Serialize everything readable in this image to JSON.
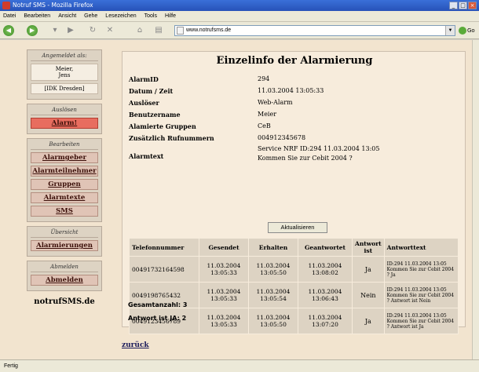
{
  "window": {
    "title": "Notruf SMS - Mozilla Firefox"
  },
  "menu": [
    "Datei",
    "Bearbeiten",
    "Ansicht",
    "Gehe",
    "Lesezeichen",
    "Tools",
    "Hilfe"
  ],
  "navbar": {
    "url": "www.notrufsms.de",
    "go_label": "Go"
  },
  "sidebar": {
    "logged_in_head": "Angemeldet als:",
    "user_line1": "Meier,",
    "user_line2": "Jens",
    "org": "[IDK Dresden]",
    "trigger_head": "Auslösen",
    "alarm_link": "Alarm!",
    "edit_head": "Bearbeiten",
    "edit_links": [
      "Alarmgeber",
      "Alarmteilnehmer",
      "Gruppen",
      "Alarmtexte",
      "SMS"
    ],
    "overview_head": "Übersicht",
    "overview_link": "Alarmierungen",
    "logout_head": "Abmelden",
    "logout_link": "Abmelden",
    "brand": "notrufSMS.de"
  },
  "main": {
    "title": "Einzelinfo der Alarmierung",
    "fields": [
      {
        "label": "AlarmID",
        "value": "294"
      },
      {
        "label": "Datum / Zeit",
        "value": "11.03.2004 13:05:33"
      },
      {
        "label": "Auslöser",
        "value": "Web-Alarm"
      },
      {
        "label": "Benutzername",
        "value": "Meier"
      },
      {
        "label": "Alamierte Gruppen",
        "value": "CeB"
      },
      {
        "label": "Zusätzlich Rufnummern",
        "value": "004912345678"
      }
    ],
    "alarm_text_label": "Alarmtext",
    "alarm_text_line1": "Service NRF ID:294 11.03.2004 13:05",
    "alarm_text_line2": "Kommen Sie zur Cebit 2004 ?",
    "refresh_label": "Aktualisieren",
    "table": {
      "headers": [
        "Telefonnummer",
        "Gesendet",
        "Erhalten",
        "Geantwortet",
        "Antwort ist",
        "Antworttext"
      ],
      "rows": [
        {
          "phone": "00491732164598",
          "sent": "11.03.2004 13:05:33",
          "received": "11.03.2004 13:05:50",
          "answered": "11.03.2004 13:08:02",
          "answer": "Ja",
          "reply": "ID:294 11.03.2004 13:05 Kommen Sie zur Cebit 2004 ? Ja"
        },
        {
          "phone": "0049198765432",
          "sent": "11.03.2004 13:05:33",
          "received": "11.03.2004 13:05:54",
          "answered": "11.03.2004 13:06:43",
          "answer": "Nein",
          "reply": "ID:294 11.03.2004 13:05 Kommen Sie zur Cebit 2004 ? Antwort ist Nein"
        },
        {
          "phone": "0049123456789",
          "sent": "11.03.2004 13:05:33",
          "received": "11.03.2004 13:05:50",
          "answered": "11.03.2004 13:07:20",
          "answer": "Ja",
          "reply": "ID:294 11.03.2004 13:05 Kommen Sie zur Cebit 2004 ? Antwort ist Ja"
        }
      ]
    },
    "total": "Gesamtanzahl: 3",
    "yes_count": "Antwort ist JA: 2"
  },
  "back_link": "zurück",
  "status": "Fertig"
}
